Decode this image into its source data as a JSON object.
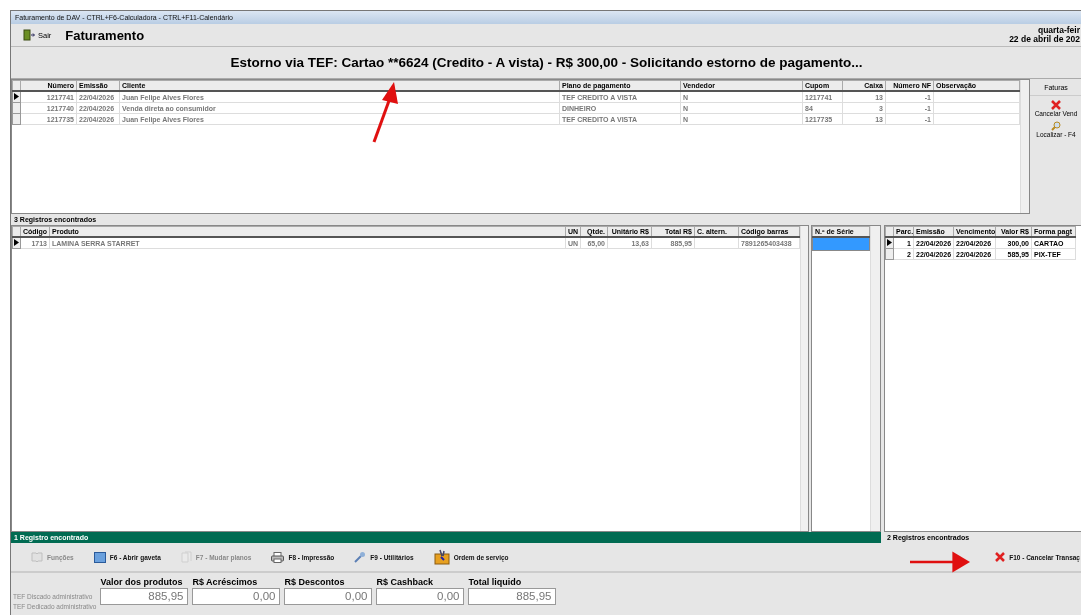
{
  "window": {
    "title": "Faturamento de DAV -  CTRL+F6-Calculadora - CTRL+F11-Calendário"
  },
  "toolbar": {
    "exit_label": "Sair",
    "title": "Faturamento",
    "date_lines": [
      "quarta-feir",
      "22 de abril de 202"
    ]
  },
  "banner": "Estorno via TEF: Cartao **6624 (Credito - A vista) - R$ 300,00 - Solicitando estorno de pagamento...",
  "invoices": {
    "columns": [
      "Número",
      "Emissão",
      "Cliente",
      "Plano de pagamento",
      "Vendedor",
      "Cupom",
      "Caixa",
      "Número NF",
      "Observação"
    ],
    "rows": [
      {
        "selected": true,
        "cells": [
          "1217741",
          "22/04/2026",
          "Juan Felipe Alves Flores",
          "TEF CREDITO A VISTA",
          "N",
          "1217741",
          "13",
          "-1"
        ]
      },
      {
        "selected": false,
        "cells": [
          "1217740",
          "22/04/2026",
          "Venda direta ao consumidor",
          "DINHEIRO",
          "N",
          "84",
          "3",
          "-1"
        ]
      },
      {
        "selected": false,
        "cells": [
          "1217735",
          "22/04/2026",
          "Juan Felipe Alves Flores",
          "TEF CREDITO A VISTA",
          "N",
          "1217735",
          "13",
          "-1"
        ]
      }
    ],
    "status": "3 Registros encontrados"
  },
  "side_panel": {
    "title": "Faturas",
    "actions": [
      {
        "kind": "cancel",
        "label": "Cancelar Vend"
      },
      {
        "kind": "search",
        "label": "Localizar - F4"
      }
    ]
  },
  "products": {
    "columns": [
      "Código",
      "Produto",
      "UN",
      "Qtde.",
      "Unitário R$",
      "Total R$",
      "C. altern.",
      "Código barras"
    ],
    "rows": [
      {
        "selected": true,
        "cells": [
          "1713",
          "LAMINA SERRA STARRET",
          "UN",
          "65,00",
          "13,63",
          "885,95",
          "",
          "7891265403438"
        ]
      }
    ],
    "status": "1 Registro encontrado"
  },
  "serial": {
    "column": "N.º de Série",
    "rows": [
      {
        "selected": true
      }
    ]
  },
  "installments": {
    "columns": [
      "Parc.",
      "Emissão",
      "Vencimento",
      "Valor R$",
      "Forma pagt"
    ],
    "rows": [
      {
        "selected": true,
        "cells": [
          "1",
          "22/04/2026",
          "22/04/2026",
          "300,00",
          "CARTAO"
        ]
      },
      {
        "selected": false,
        "cells": [
          "2",
          "22/04/2026",
          "22/04/2026",
          "585,95",
          "PIX-TEF"
        ]
      }
    ],
    "status": "2 Registros encontrados"
  },
  "actions": [
    {
      "kind": "book",
      "label": "Funções",
      "disabled": true
    },
    {
      "kind": "drawer",
      "label": "F6 - Abrir gaveta",
      "disabled": false
    },
    {
      "kind": "docs",
      "label": "F7 - Mudar planos",
      "disabled": true
    },
    {
      "kind": "printer",
      "label": "F8 - Impressão",
      "disabled": false
    },
    {
      "kind": "wrench",
      "label": "F9 - Utilitários",
      "disabled": false
    },
    {
      "kind": "toolbox",
      "label": "Ordem de serviço",
      "disabled": false
    }
  ],
  "cancel_action": {
    "label": "F10 - Cancelar Transaç"
  },
  "tef_links": [
    {
      "label": "TEF Discado administrativo",
      "disabled": true
    },
    {
      "label": "TEF Dedicado administrativo",
      "disabled": true
    }
  ],
  "totals": [
    {
      "label": "Valor dos produtos",
      "value": "885,95"
    },
    {
      "label": "R$ Acréscimos",
      "value": "0,00"
    },
    {
      "label": "R$ Descontos",
      "value": "0,00"
    },
    {
      "label": "R$ Cashback",
      "value": "0,00"
    },
    {
      "label": "Total liquido",
      "value": "885,95"
    }
  ]
}
